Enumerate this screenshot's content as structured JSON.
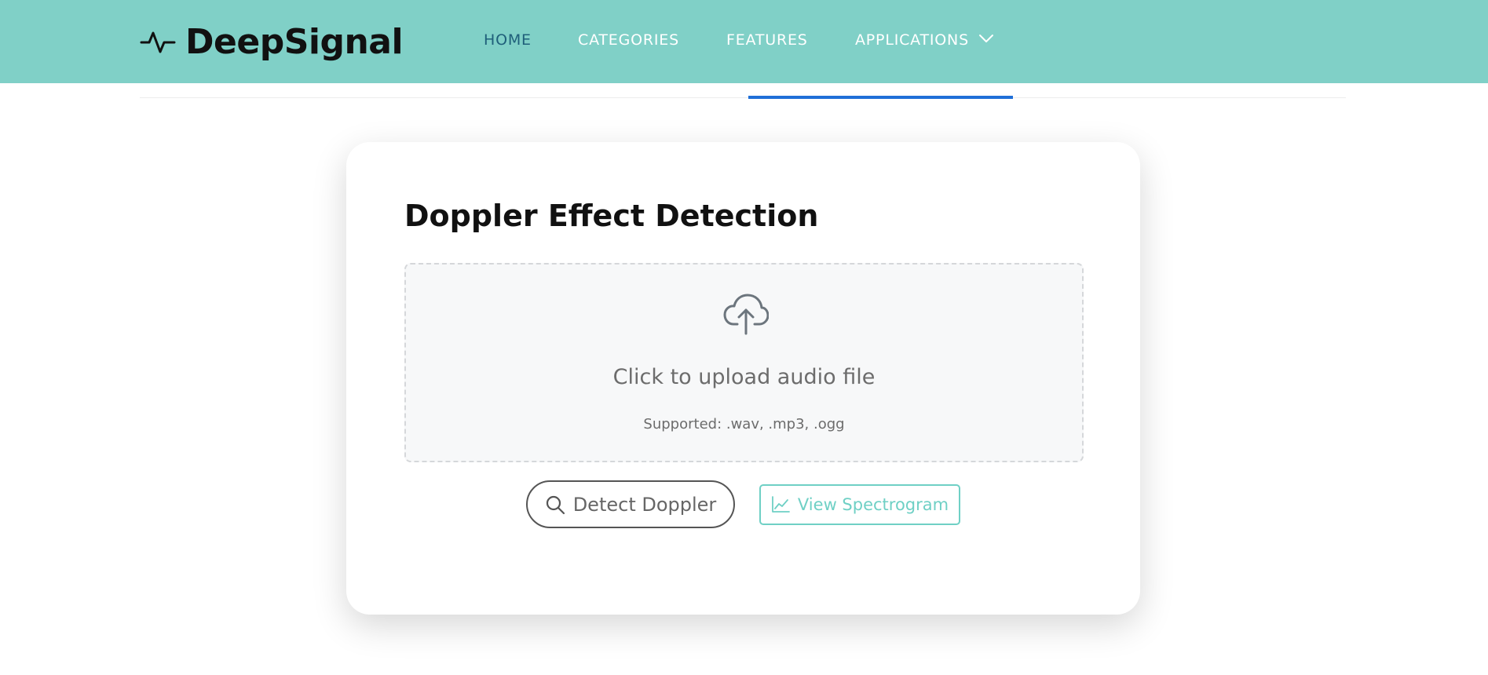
{
  "brand": {
    "name": "DeepSignal",
    "icon": "pulse-icon"
  },
  "nav": {
    "items": [
      {
        "label": "HOME",
        "active": true
      },
      {
        "label": "CATEGORIES",
        "active": false
      },
      {
        "label": "FEATURES",
        "active": false
      },
      {
        "label": "APPLICATIONS",
        "active": false,
        "icon": "chevron-down-icon"
      }
    ]
  },
  "card": {
    "title": "Doppler Effect Detection",
    "upload": {
      "icon": "cloud-upload-icon",
      "prompt": "Click to upload audio file",
      "supported": "Supported: .wav, .mp3, .ogg"
    },
    "buttons": {
      "detect": {
        "label": "Detect Doppler",
        "icon": "search-icon"
      },
      "spectrogram": {
        "label": "View Spectrogram",
        "icon": "line-chart-icon"
      }
    }
  },
  "colors": {
    "header_bg": "#80d0c7",
    "active_nav": "#1f5f7a",
    "indicator": "#1f6fd8",
    "accent": "#6fd0c5"
  }
}
